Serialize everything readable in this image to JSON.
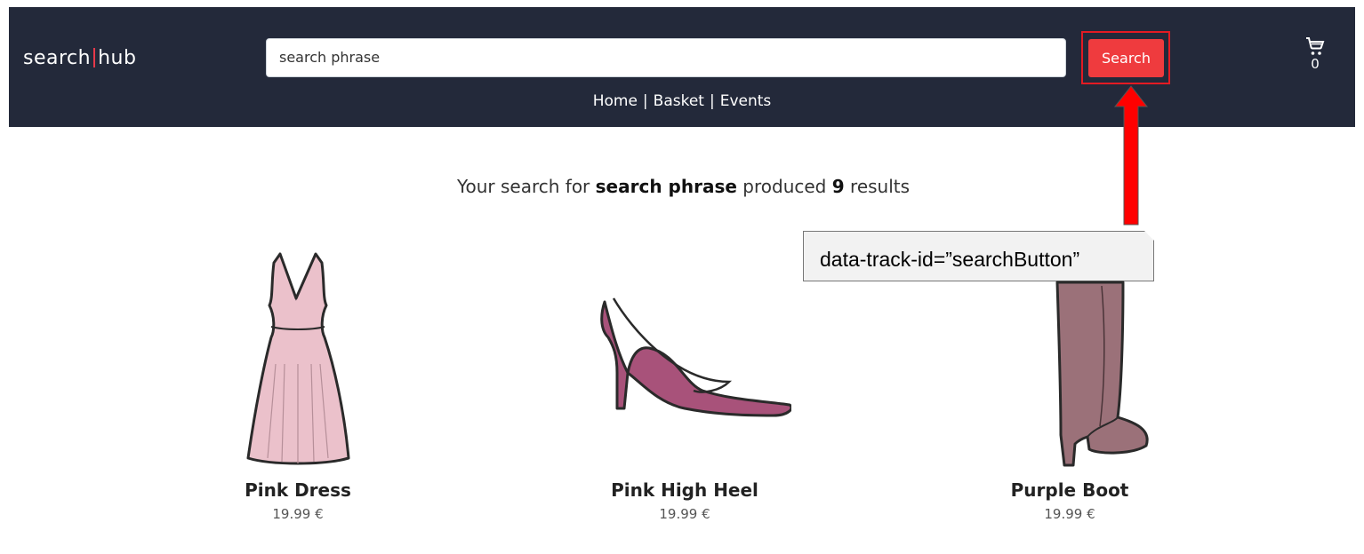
{
  "header": {
    "logo": {
      "left": "search",
      "right": "hub"
    },
    "search": {
      "value": "search phrase",
      "placeholder": ""
    },
    "search_button_label": "Search",
    "cart": {
      "icon": "cart-icon",
      "count": "0"
    },
    "nav": {
      "home": "Home",
      "basket": "Basket",
      "events": "Events",
      "separator": "|"
    }
  },
  "results": {
    "prefix": "Your search for",
    "query": "search phrase",
    "middle": "produced",
    "count": "9",
    "suffix": "results"
  },
  "annotation": {
    "callout_text": "data-track-id=”searchButton”",
    "arrow_color": "#ff0000",
    "box_color": "#e31b23"
  },
  "products": [
    {
      "name": "Pink Dress",
      "price": "19.99 €",
      "image": "pink-dress"
    },
    {
      "name": "Pink High Heel",
      "price": "19.99 €",
      "image": "pink-high-heel"
    },
    {
      "name": "Purple Boot",
      "price": "19.99 €",
      "image": "purple-boot"
    }
  ],
  "colors": {
    "header_bg": "#23293a",
    "accent": "#ef3b3e"
  }
}
